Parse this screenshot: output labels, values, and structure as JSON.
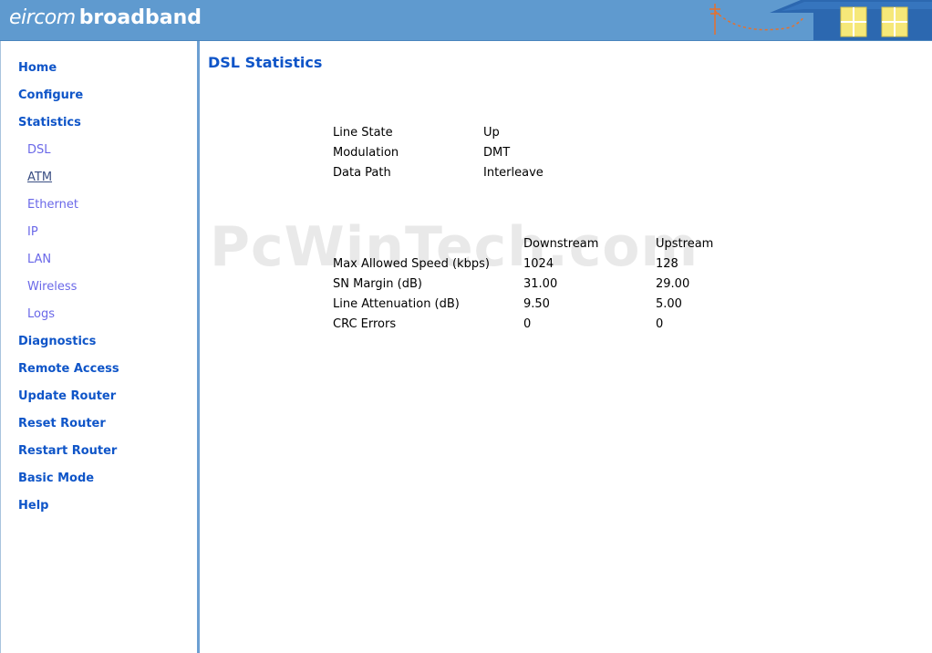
{
  "header": {
    "brand_light": "eircom",
    "brand_bold": "broadband"
  },
  "sidebar": {
    "items": [
      {
        "label": "Home",
        "level": "main"
      },
      {
        "label": "Configure",
        "level": "main"
      },
      {
        "label": "Statistics",
        "level": "main"
      },
      {
        "label": "DSL",
        "level": "sub"
      },
      {
        "label": "ATM",
        "level": "sub",
        "underlined": true
      },
      {
        "label": "Ethernet",
        "level": "sub"
      },
      {
        "label": "IP",
        "level": "sub"
      },
      {
        "label": "LAN",
        "level": "sub"
      },
      {
        "label": "Wireless",
        "level": "sub"
      },
      {
        "label": "Logs",
        "level": "sub"
      },
      {
        "label": "Diagnostics",
        "level": "main"
      },
      {
        "label": "Remote Access",
        "level": "main"
      },
      {
        "label": "Update Router",
        "level": "main"
      },
      {
        "label": "Reset Router",
        "level": "main"
      },
      {
        "label": "Restart Router",
        "level": "main"
      },
      {
        "label": "Basic Mode",
        "level": "main"
      },
      {
        "label": "Help",
        "level": "main"
      }
    ]
  },
  "main": {
    "title": "DSL Statistics",
    "line_info": [
      {
        "label": "Line State",
        "value": "Up"
      },
      {
        "label": "Modulation",
        "value": "DMT"
      },
      {
        "label": "Data Path",
        "value": "Interleave"
      }
    ],
    "metrics": {
      "headers": [
        "",
        "Downstream",
        "Upstream"
      ],
      "rows": [
        {
          "label": "Max Allowed Speed (kbps)",
          "downstream": "1024",
          "upstream": "128"
        },
        {
          "label": "SN Margin (dB)",
          "downstream": "31.00",
          "upstream": "29.00"
        },
        {
          "label": "Line Attenuation (dB)",
          "downstream": "9.50",
          "upstream": "5.00"
        },
        {
          "label": "CRC Errors",
          "downstream": "0",
          "upstream": "0"
        }
      ]
    }
  },
  "watermark": "PcWinTech.com",
  "colors": {
    "header_bg": "#5f9acf",
    "nav_main": "#0f55c8",
    "nav_sub": "#6a68e8",
    "title": "#0f55c8",
    "divider": "#6c9fd2"
  }
}
